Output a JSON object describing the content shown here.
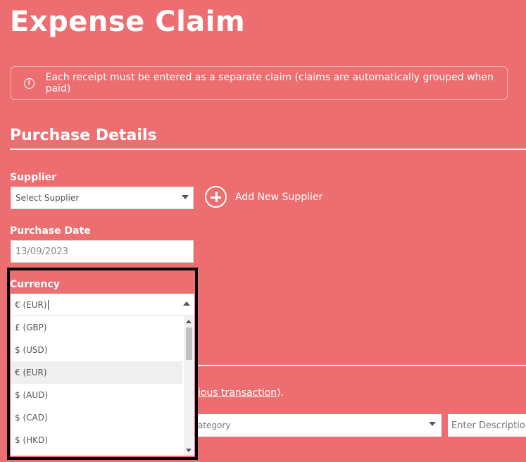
{
  "page_title": "Expense Claim",
  "info_message": "Each receipt must be entered as a separate claim (claims are automatically grouped when paid)",
  "info_icon": "i",
  "section_title": "Purchase Details",
  "supplier": {
    "label": "Supplier",
    "placeholder": "Select Supplier",
    "add_label": "Add New Supplier"
  },
  "purchase_date": {
    "label": "Purchase Date",
    "value": "13/09/2023"
  },
  "currency": {
    "label": "Currency",
    "value": "€ (EUR)",
    "options": [
      "£ (GBP)",
      "$ (USD)",
      "€ (EUR)",
      "$ (AUD)",
      "$ (CAD)",
      "$ (HKD)"
    ],
    "selected_index": 2
  },
  "transaction_link": {
    "visible_text": "ious transaction",
    "suffix": ")."
  },
  "category": {
    "placeholder_fragment": "ategory"
  },
  "description": {
    "placeholder_fragment": "Enter Descriptio"
  },
  "colors": {
    "background": "#ec6e70",
    "highlight_frame": "#000000"
  }
}
